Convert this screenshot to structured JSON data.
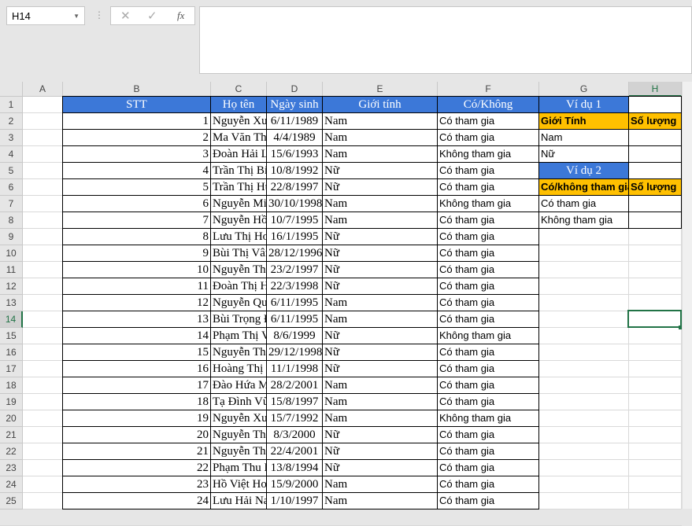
{
  "namebox": "H14",
  "formula_bar": {
    "cancel_icon": "✕",
    "enter_icon": "✓",
    "fx_label": "fx"
  },
  "columns": [
    "A",
    "B",
    "C",
    "D",
    "E",
    "F",
    "G",
    "H"
  ],
  "headers": {
    "stt": "STT",
    "name": "Họ tên",
    "dob": "Ngày sinh",
    "gender": "Giới tính",
    "participation": "Có/Không"
  },
  "rows": [
    [
      "1",
      "Nguyễn Xuân Bách",
      "6/11/1989",
      "Nam",
      "Có tham gia"
    ],
    [
      "2",
      "Ma Văn Thoại",
      "4/4/1989",
      "Nam",
      "Có tham gia"
    ],
    [
      "3",
      "Đoàn Hải Long",
      "15/6/1993",
      "Nam",
      "Không tham gia"
    ],
    [
      "4",
      "Trần Thị Bích Chi",
      "10/8/1992",
      "Nữ",
      "Có tham gia"
    ],
    [
      "5",
      "Trần Thị Huyền",
      "22/8/1997",
      "Nữ",
      "Có tham gia"
    ],
    [
      "6",
      "Nguyễn Minh Hoàng",
      "30/10/1998",
      "Nam",
      "Không tham gia"
    ],
    [
      "7",
      "Nguyễn Hồng Quân",
      "10/7/1995",
      "Nam",
      "Có tham gia"
    ],
    [
      "8",
      "Lưu Thị Hoàng Ngân",
      "16/1/1995",
      "Nữ",
      "Có tham gia"
    ],
    [
      "9",
      "Bùi Thị Vân Anh",
      "28/12/1996",
      "Nữ",
      "Có tham gia"
    ],
    [
      "10",
      "Nguyễn Thị Phương Anh",
      "23/2/1997",
      "Nữ",
      "Có tham gia"
    ],
    [
      "11",
      "Đoàn Thị Hải Vân",
      "22/3/1998",
      "Nữ",
      "Có tham gia"
    ],
    [
      "12",
      "Nguyễn Quang Nam",
      "6/11/1995",
      "Nam",
      "Có tham gia"
    ],
    [
      "13",
      "Bùi Trọng Đài",
      "6/11/1995",
      "Nam",
      "Có tham gia"
    ],
    [
      "14",
      "Phạm Thị Vân Anh",
      "8/6/1999",
      "Nữ",
      "Không tham gia"
    ],
    [
      "15",
      "Nguyễn Thảo Vân",
      "29/12/1998",
      "Nữ",
      "Có tham gia"
    ],
    [
      "16",
      "Hoàng Thị Quỳnh Anh",
      "11/1/1998",
      "Nữ",
      "Có tham gia"
    ],
    [
      "17",
      "Đào Hứa Minh Dương",
      "28/2/2001",
      "Nam",
      "Có tham gia"
    ],
    [
      "18",
      "Tạ Đình Vũ",
      "15/8/1997",
      "Nam",
      "Có tham gia"
    ],
    [
      "19",
      "Nguyễn Xuân Ca",
      "15/7/1992",
      "Nam",
      "Không tham gia"
    ],
    [
      "20",
      "Nguyễn Thị Xuân",
      "8/3/2000",
      "Nữ",
      "Có tham gia"
    ],
    [
      "21",
      "Nguyễn Thị Huyền Nhi",
      "22/4/2001",
      "Nữ",
      "Có tham gia"
    ],
    [
      "22",
      "Phạm Thu Hà",
      "13/8/1994",
      "Nữ",
      "Có tham gia"
    ],
    [
      "23",
      "Hồ Việt Hoàng",
      "15/9/2000",
      "Nam",
      "Có tham gia"
    ],
    [
      "24",
      "Lưu Hải Nam",
      "1/10/1997",
      "Nam",
      "Có tham gia"
    ]
  ],
  "example1": {
    "title": "Ví dụ 1",
    "col1": "Giới Tính",
    "col2": "Số lượng",
    "items": [
      "Nam",
      "Nữ"
    ]
  },
  "example2": {
    "title": "Ví dụ 2",
    "col1": "Có/không tham gia",
    "col2": "Số lượng",
    "items": [
      "Có tham gia",
      "Không tham gia"
    ]
  },
  "colors": {
    "header_blue": "#3c78d8",
    "orange": "#ffc000",
    "select_green": "#217346"
  }
}
